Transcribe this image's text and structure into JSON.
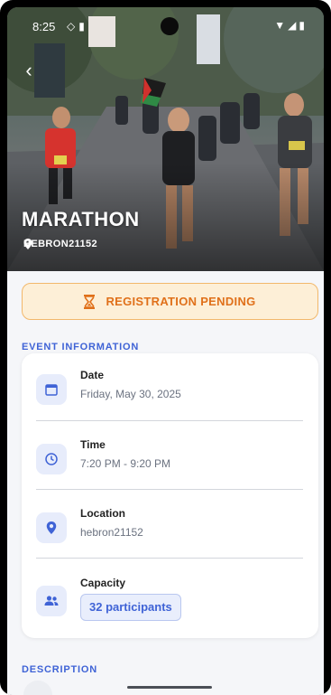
{
  "status_bar": {
    "time": "8:25",
    "left_icons": [
      "shield-icon",
      "sim-card-icon"
    ],
    "right_icons": [
      "wifi-icon",
      "cell-signal-icon",
      "battery-icon"
    ]
  },
  "hero": {
    "title": "MARATHON",
    "location": "HEBRON21152"
  },
  "registration_status": {
    "text": "REGISTRATION PENDING",
    "icon": "hourglass-icon",
    "color": "#e0701a"
  },
  "event_info": {
    "section_title": "EVENT INFORMATION",
    "date": {
      "label": "Date",
      "value": "Friday, May 30, 2025",
      "icon": "calendar-icon"
    },
    "time": {
      "label": "Time",
      "value": "7:20 PM - 9:20 PM",
      "icon": "clock-icon"
    },
    "location": {
      "label": "Location",
      "value": "hebron21152",
      "icon": "map-pin-icon"
    },
    "capacity": {
      "label": "Capacity",
      "value": "32 participants",
      "icon": "people-icon"
    }
  },
  "description": {
    "section_title": "DESCRIPTION"
  },
  "colors": {
    "accent": "#3f63d6",
    "pending_bg": "#fdefd7",
    "pending_border": "#f2b86b"
  }
}
